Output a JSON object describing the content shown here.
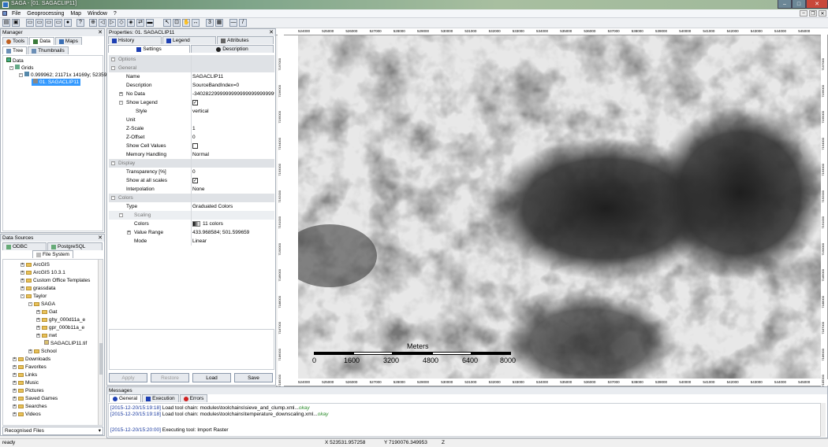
{
  "app": {
    "title": "SAGA - [01. SAGACLIP11]"
  },
  "menu": [
    "File",
    "Geoprocessing",
    "Map",
    "Window",
    "?"
  ],
  "manager": {
    "title": "Manager",
    "tabs": [
      "Tools",
      "Data",
      "Maps"
    ],
    "subtabs": [
      "Tree",
      "Thumbnails"
    ],
    "tree": {
      "root": "Data",
      "grids": "Grids",
      "system": "0.999962; 21171x 14169y; 52359",
      "item": "01. SAGACLIP11"
    }
  },
  "datasources": {
    "title": "Data Sources",
    "tabs": [
      "ODBC",
      "PostgreSQL"
    ],
    "subtab": "File System",
    "items": [
      "ArcGIS",
      "ArcGIS 10.3.1",
      "Custom Office Templates",
      "grassdata",
      "Taylor",
      "SAGA",
      "Gat",
      "ghy_000d11a_e",
      "gpr_000b11a_e",
      "nwt",
      "SAGACLIP11.tif",
      "School",
      "Downloads",
      "Favorites",
      "Links",
      "Music",
      "Pictures",
      "Saved Games",
      "Searches",
      "Videos"
    ],
    "footer": "Recognised Files"
  },
  "properties": {
    "title": "Properties: 01. SAGACLIP11",
    "tabs_top": [
      "History",
      "Legend",
      "Attributes"
    ],
    "tabs_bottom": [
      "Settings",
      "Description"
    ],
    "rows": {
      "options": "Options",
      "general": "General",
      "name_k": "Name",
      "name_v": "SAGACLIP11",
      "desc_k": "Description",
      "desc_v": "SourceBandIndex=0",
      "nodata_k": "No Data",
      "nodata_v": "-340282299999999999999999999999999",
      "showlegend_k": "Show Legend",
      "style_k": "Style",
      "style_v": "vertical",
      "unit_k": "Unit",
      "zscale_k": "Z-Scale",
      "zscale_v": "1",
      "zoffset_k": "Z-Offset",
      "zoffset_v": "0",
      "showcell_k": "Show Cell Values",
      "memory_k": "Memory Handling",
      "memory_v": "Normal",
      "display": "Display",
      "transp_k": "Transparency [%]",
      "transp_v": "0",
      "showall_k": "Show at all scales",
      "interp_k": "Interpolation",
      "interp_v": "None",
      "colors": "Colors",
      "type_k": "Type",
      "type_v": "Graduated Colors",
      "scaling": "Scaling",
      "colors_k": "Colors",
      "colors_v": "11 colors",
      "range_k": "Value Range",
      "range_v": "433.968584; 501.599659",
      "mode_k": "Mode",
      "mode_v": "Linear"
    },
    "buttons": [
      "Apply",
      "Restore",
      "Load",
      "Save"
    ]
  },
  "map": {
    "x_ticks": [
      "524000",
      "525000",
      "526000",
      "527000",
      "528000",
      "529000",
      "530000",
      "531000",
      "532000",
      "533000",
      "534000",
      "535000",
      "536000",
      "537000",
      "538000",
      "539000",
      "540000",
      "541000",
      "542000",
      "543000",
      "544000",
      "545000"
    ],
    "y_ticks": [
      "7197000",
      "7196000",
      "7195000",
      "7194000",
      "7193000",
      "7192000",
      "7191000",
      "7190000",
      "7189000",
      "7188000",
      "7187000",
      "7186000",
      "7185000"
    ],
    "scalebar": {
      "title": "Meters",
      "labels": [
        "0",
        "1600",
        "3200",
        "4800",
        "6400",
        "8000"
      ]
    }
  },
  "messages": {
    "title": "Messages",
    "tabs": [
      "General",
      "Execution",
      "Errors"
    ],
    "lines": [
      {
        "ts": "[2015-12-20/15:19:18]",
        "text": "Load tool chain: modules\\toolchains\\sieve_and_clump.xml...",
        "ok": "okay"
      },
      {
        "ts": "[2015-12-20/15:19:18]",
        "text": "Load tool chain: modules\\toolchains\\temperature_downscaling.xml...",
        "ok": "okay"
      },
      {
        "ts": "[2015-12-20/15:20:00]",
        "text": "Executing tool: Import Raster",
        "ok": ""
      }
    ]
  },
  "status": {
    "left": "ready",
    "x": "X 523531.957258",
    "y": "Y 7190076.349953",
    "z": "Z"
  }
}
